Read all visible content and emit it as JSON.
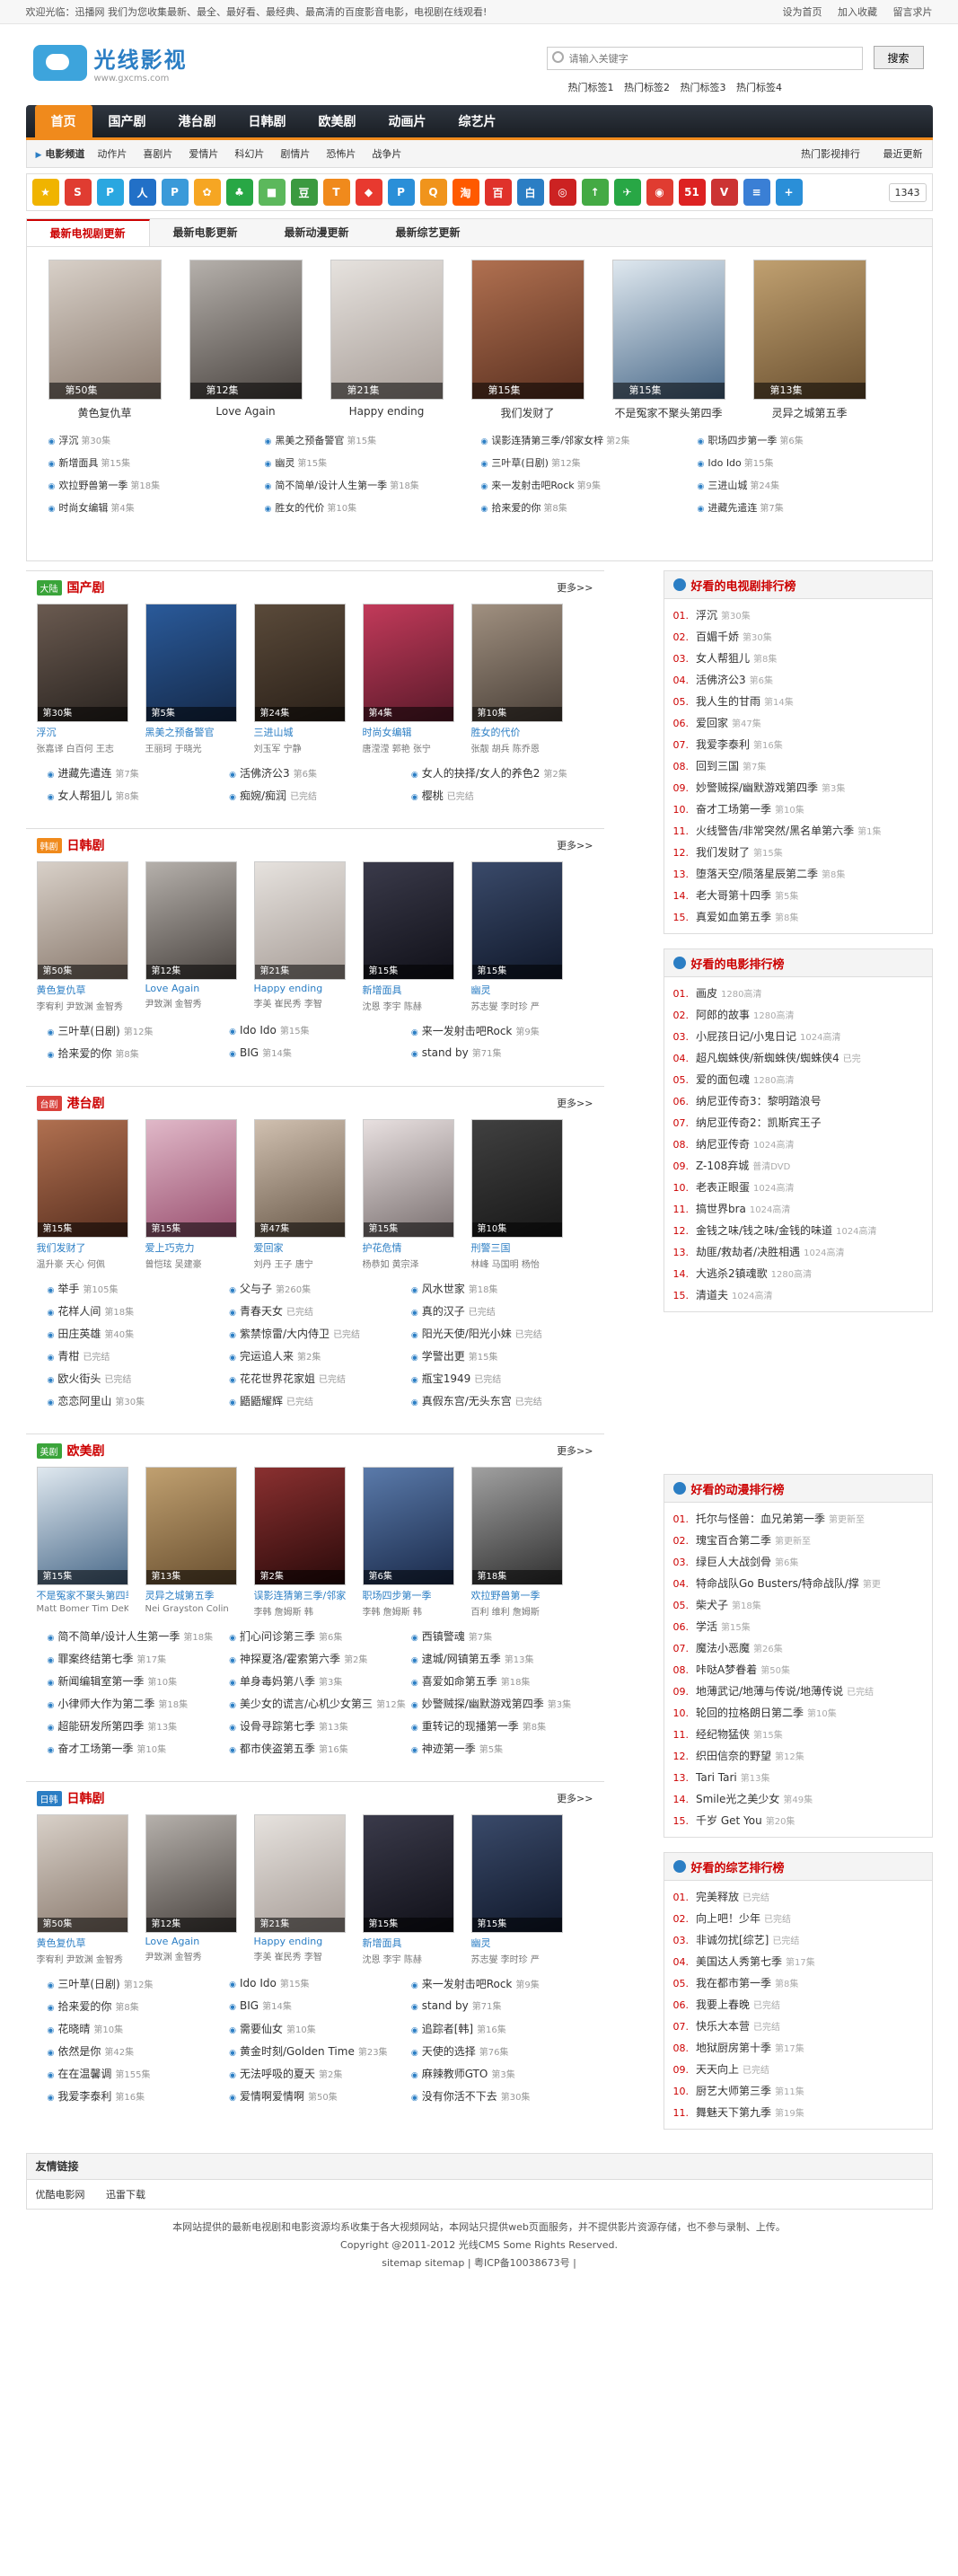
{
  "topbar": {
    "welcome": "欢迎光临：迅播网 我们为您收集最新、最全、最好看、最经典、最高清的百度影音电影，电视剧在线观看!",
    "links": [
      "设为首页",
      "加入收藏",
      "留言求片"
    ]
  },
  "header": {
    "logo_name": "光线影视",
    "logo_domain": "www.gxcms.com",
    "search_placeholder": "请输入关键字",
    "search_button": "搜索",
    "hotwords": [
      "热门标签1",
      "热门标签2",
      "热门标签3",
      "热门标签4"
    ]
  },
  "nav": {
    "items": [
      "首页",
      "国产剧",
      "港台剧",
      "日韩剧",
      "欧美剧",
      "动画片",
      "综艺片"
    ]
  },
  "subnav": {
    "label": "电影频道",
    "cats": [
      "动作片",
      "喜剧片",
      "爱情片",
      "科幻片",
      "剧情片",
      "恐怖片",
      "战争片"
    ],
    "right": [
      "热门影视排行",
      "最近更新"
    ]
  },
  "iconbar": {
    "icons": [
      {
        "t": "★",
        "c": "#f0b400"
      },
      {
        "t": "S",
        "c": "#e03c31"
      },
      {
        "t": "P",
        "c": "#2aa7e0"
      },
      {
        "t": "人",
        "c": "#2270c7"
      },
      {
        "t": "P",
        "c": "#3a9ad9"
      },
      {
        "t": "✿",
        "c": "#f6a623"
      },
      {
        "t": "♣",
        "c": "#28a745"
      },
      {
        "t": "■",
        "c": "#5cb85c"
      },
      {
        "t": "豆",
        "c": "#3b9a40"
      },
      {
        "t": "T",
        "c": "#f08a1c"
      },
      {
        "t": "◆",
        "c": "#e8392f"
      },
      {
        "t": "P",
        "c": "#2a8fd8"
      },
      {
        "t": "Q",
        "c": "#f0941c"
      },
      {
        "t": "淘",
        "c": "#ff5a00"
      },
      {
        "t": "百",
        "c": "#e0322b"
      },
      {
        "t": "白",
        "c": "#2b7ec4"
      },
      {
        "t": "◎",
        "c": "#cc2222"
      },
      {
        "t": "↑",
        "c": "#44aa44"
      },
      {
        "t": "✈",
        "c": "#28a745"
      },
      {
        "t": "◉",
        "c": "#e03c31"
      },
      {
        "t": "51",
        "c": "#dd2222"
      },
      {
        "t": "V",
        "c": "#cc3333"
      },
      {
        "t": "≡",
        "c": "#3a7fd5"
      },
      {
        "t": "+",
        "c": "#2a8fd8"
      }
    ],
    "count": "1343"
  },
  "newbox": {
    "tabs": [
      "最新电视剧更新",
      "最新电影更新",
      "最新动漫更新",
      "最新综艺更新"
    ],
    "posters": [
      {
        "ep": "第50集",
        "title": "黄色复仇草",
        "c1": "#d8d0c8",
        "c2": "#8a7a6e"
      },
      {
        "ep": "第12集",
        "title": "Love Again",
        "c1": "#b5b0ab",
        "c2": "#4a4440"
      },
      {
        "ep": "第21集",
        "title": "Happy ending",
        "c1": "#e6e2de",
        "c2": "#a79d97"
      },
      {
        "ep": "第15集",
        "title": "我们发财了",
        "c1": "#b07050",
        "c2": "#5a3020"
      },
      {
        "ep": "第15集",
        "title": "不是冤家不聚头第四季",
        "c1": "#dfe8ef",
        "c2": "#4a6a8a"
      },
      {
        "ep": "第13集",
        "title": "灵异之城第五季",
        "c1": "#c0a070",
        "c2": "#6a5030"
      }
    ],
    "list": [
      {
        "t": "浮沉",
        "s": "第30集"
      },
      {
        "t": "黑美之预备警官",
        "s": "第15集"
      },
      {
        "t": "误影连猜第三季/邻家女梓",
        "s": "第2集"
      },
      {
        "t": "职场四步第一季",
        "s": "第6集"
      },
      {
        "t": "新增面具",
        "s": "第15集"
      },
      {
        "t": "幽灵",
        "s": "第15集"
      },
      {
        "t": "三叶草(日剧)",
        "s": "第12集"
      },
      {
        "t": "Ido Ido",
        "s": "第15集"
      },
      {
        "t": "欢拉野兽第一季",
        "s": "第18集"
      },
      {
        "t": "简不简单/设计人生第一季",
        "s": "第18集"
      },
      {
        "t": "来一发射击吧Rock",
        "s": "第9集"
      },
      {
        "t": "三进山城",
        "s": "第24集"
      },
      {
        "t": "时尚女编辑",
        "s": "第4集"
      },
      {
        "t": "胜女的代价",
        "s": "第10集"
      },
      {
        "t": "拾来爱的你",
        "s": "第8集"
      },
      {
        "t": "进藏先遣连",
        "s": "第7集"
      }
    ]
  },
  "sections": [
    {
      "badge": "大陆",
      "bc": "#3aa43a",
      "title": "国产剧",
      "more": "更多>>",
      "posters": [
        {
          "ep": "第30集",
          "title": "浮沉",
          "actors": "张嘉译 白百何 王志",
          "c1": "#6a5a50",
          "c2": "#2a2420"
        },
        {
          "ep": "第5集",
          "title": "黑美之预备警官",
          "actors": "王丽珂 于晓光",
          "c1": "#2a5a9a",
          "c2": "#152a4a"
        },
        {
          "ep": "第24集",
          "title": "三进山城",
          "actors": "刘玉军 宁静",
          "c1": "#5a4a3a",
          "c2": "#2a2018"
        },
        {
          "ep": "第4集",
          "title": "时尚女编辑",
          "actors": "唐滢滢 郭艳 张宁",
          "c1": "#c23a5a",
          "c2": "#5a1a2a"
        },
        {
          "ep": "第10集",
          "title": "胜女的代价",
          "actors": "张靓 胡兵 陈乔恩",
          "c1": "#a09080",
          "c2": "#4a4038"
        }
      ],
      "list": [
        {
          "t": "进藏先遣连",
          "s": "第7集"
        },
        {
          "t": "活佛济公3",
          "s": "第6集"
        },
        {
          "t": "女人的抉择/女人的养色2",
          "s": "第2集"
        },
        {
          "t": "女人帮狙儿",
          "s": "第8集"
        },
        {
          "t": "痴婉/痴润",
          "s": "已完结"
        },
        {
          "t": "樱桃",
          "s": "已完结"
        }
      ]
    },
    {
      "badge": "韩剧",
      "bc": "#f08a1c",
      "title": "日韩剧",
      "more": "更多>>",
      "posters": [
        {
          "ep": "第50集",
          "title": "黄色复仇草",
          "actors": "李宥利 尹致渊 金智秀",
          "c1": "#d8d0c8",
          "c2": "#8a7a6e"
        },
        {
          "ep": "第12集",
          "title": "Love Again",
          "actors": "尹致渊 金智秀",
          "c1": "#b5b0ab",
          "c2": "#4a4440"
        },
        {
          "ep": "第21集",
          "title": "Happy ending",
          "actors": "李美 崔民秀 李智",
          "c1": "#e6e2de",
          "c2": "#a79d97"
        },
        {
          "ep": "第15集",
          "title": "新增面具",
          "actors": "沈恩 李宇 陈赫",
          "c1": "#3a3a4a",
          "c2": "#101018"
        },
        {
          "ep": "第15集",
          "title": "幽灵",
          "actors": "苏志燮 李时珍 严",
          "c1": "#3a4a6a",
          "c2": "#10182a"
        }
      ],
      "list": [
        {
          "t": "三叶草(日剧)",
          "s": "第12集"
        },
        {
          "t": "Ido Ido",
          "s": "第15集"
        },
        {
          "t": "来一发射击吧Rock",
          "s": "第9集"
        },
        {
          "t": "拾来爱的你",
          "s": "第8集"
        },
        {
          "t": "BIG",
          "s": "第14集"
        },
        {
          "t": "stand by",
          "s": "第71集"
        }
      ]
    },
    {
      "badge": "台剧",
      "bc": "#d9413b",
      "title": "港台剧",
      "more": "更多>>",
      "posters": [
        {
          "ep": "第15集",
          "title": "我们发财了",
          "actors": "温升豪 天心 何佩",
          "c1": "#b07050",
          "c2": "#5a3020"
        },
        {
          "ep": "第15集",
          "title": "爱上巧克力",
          "actors": "曾恺玹 吴建豪",
          "c1": "#e0b8c8",
          "c2": "#9a5070"
        },
        {
          "ep": "第47集",
          "title": "爱回家",
          "actors": "刘丹 王子 唐宁",
          "c1": "#d0c0b0",
          "c2": "#6a5a4a"
        },
        {
          "ep": "第15集",
          "title": "护花危情",
          "actors": "杨恭如 黄宗泽",
          "c1": "#e8e0e0",
          "c2": "#7a7070"
        },
        {
          "ep": "第10集",
          "title": "刑警三国",
          "actors": "林峰 马国明 杨怡",
          "c1": "#404040",
          "c2": "#181818"
        }
      ],
      "list": [
        {
          "t": "举手",
          "s": "第105集"
        },
        {
          "t": "父与子",
          "s": "第260集"
        },
        {
          "t": "风水世家",
          "s": "第18集"
        },
        {
          "t": "花样人间",
          "s": "第18集"
        },
        {
          "t": "青春天女",
          "s": "已完结"
        },
        {
          "t": "真的汉子",
          "s": "已完结"
        },
        {
          "t": "田庄英雄",
          "s": "第40集"
        },
        {
          "t": "紫禁惊雷/大内侍卫",
          "s": "已完结"
        },
        {
          "t": "阳光天使/阳光小妹",
          "s": "已完结"
        },
        {
          "t": "青柑",
          "s": "已完结"
        },
        {
          "t": "完运追人来",
          "s": "第2集"
        },
        {
          "t": "学警出更",
          "s": "第15集"
        },
        {
          "t": "欧火街头",
          "s": "已完结"
        },
        {
          "t": "花花世界花家姐",
          "s": "已完结"
        },
        {
          "t": "瓶宝1949",
          "s": "已完结"
        },
        {
          "t": "恋恋阿里山",
          "s": "第30集"
        },
        {
          "t": "鼯鼯耀辉",
          "s": "已完结"
        },
        {
          "t": "真假东宫/无头东宫",
          "s": "已完结"
        }
      ]
    },
    {
      "badge": "美剧",
      "bc": "#3aa43a",
      "title": "欧美剧",
      "more": "更多>>",
      "posters": [
        {
          "ep": "第15集",
          "title": "不是冤家不聚头第四季",
          "actors": "Matt Bomer Tim DeKay",
          "c1": "#dfe8ef",
          "c2": "#4a6a8a"
        },
        {
          "ep": "第13集",
          "title": "灵异之城第五季",
          "actors": "Nei Grayston Colin",
          "c1": "#c0a070",
          "c2": "#6a5030"
        },
        {
          "ep": "第2集",
          "title": "误影连猜第三季/邻家女",
          "actors": "李韩 詹姆斯 韩",
          "c1": "#8a3030",
          "c2": "#2a0a0a"
        },
        {
          "ep": "第6集",
          "title": "职场四步第一季",
          "actors": "李韩 詹姆斯 韩",
          "c1": "#5a7aaa",
          "c2": "#1a2a4a"
        },
        {
          "ep": "第18集",
          "title": "欢拉野兽第一季",
          "actors": "百利 维利 詹姆斯",
          "c1": "#a0a0a0",
          "c2": "#303030"
        }
      ],
      "list": [
        {
          "t": "简不简单/设计人生第一季",
          "s": "第18集"
        },
        {
          "t": "扪心问诊第三季",
          "s": "第6集"
        },
        {
          "t": "西镇警魂",
          "s": "第7集"
        },
        {
          "t": "罪案终结第七季",
          "s": "第17集"
        },
        {
          "t": "神探夏洛/霍索第六季",
          "s": "第2集"
        },
        {
          "t": "逮城/网镇第五季",
          "s": "第13集"
        },
        {
          "t": "新闻编辑室第一季",
          "s": "第10集"
        },
        {
          "t": "单身毒妈第八季",
          "s": "第3集"
        },
        {
          "t": "喜爱如命第五季",
          "s": "第18集"
        },
        {
          "t": "小律师大作为第二季",
          "s": "第18集"
        },
        {
          "t": "美少女的谎言/心机少女第三",
          "s": "第12集"
        },
        {
          "t": "妙警贼探/幽默游戏第四季",
          "s": "第3集"
        },
        {
          "t": "超能研发所第四季",
          "s": "第13集"
        },
        {
          "t": "设骨寻踪第七季",
          "s": "第13集"
        },
        {
          "t": "重转记的现播第一季",
          "s": "第8集"
        },
        {
          "t": "奋才工场第一季",
          "s": "第10集"
        },
        {
          "t": "都市侠盗第五季",
          "s": "第16集"
        },
        {
          "t": "神迹第一季",
          "s": "第5集"
        }
      ]
    },
    {
      "badge": "日韩",
      "bc": "#2b7ec4",
      "title": "日韩剧",
      "more": "更多>>",
      "posters": [
        {
          "ep": "第50集",
          "title": "黄色复仇草",
          "actors": "李宥利 尹致渊 金智秀",
          "c1": "#d8d0c8",
          "c2": "#8a7a6e"
        },
        {
          "ep": "第12集",
          "title": "Love Again",
          "actors": "尹致渊 金智秀",
          "c1": "#b5b0ab",
          "c2": "#4a4440"
        },
        {
          "ep": "第21集",
          "title": "Happy ending",
          "actors": "李美 崔民秀 李智",
          "c1": "#e6e2de",
          "c2": "#a79d97"
        },
        {
          "ep": "第15集",
          "title": "新增面具",
          "actors": "沈恩 李宇 陈赫",
          "c1": "#3a3a4a",
          "c2": "#101018"
        },
        {
          "ep": "第15集",
          "title": "幽灵",
          "actors": "苏志燮 李时珍 严",
          "c1": "#3a4a6a",
          "c2": "#10182a"
        }
      ],
      "list": [
        {
          "t": "三叶草(日剧)",
          "s": "第12集"
        },
        {
          "t": "Ido Ido",
          "s": "第15集"
        },
        {
          "t": "来一发射击吧Rock",
          "s": "第9集"
        },
        {
          "t": "拾来爱的你",
          "s": "第8集"
        },
        {
          "t": "BIG",
          "s": "第14集"
        },
        {
          "t": "stand by",
          "s": "第71集"
        },
        {
          "t": "花晓晴",
          "s": "第10集"
        },
        {
          "t": "需要仙女",
          "s": "第10集"
        },
        {
          "t": "追踪者[韩]",
          "s": "第16集"
        },
        {
          "t": "依然是你",
          "s": "第42集"
        },
        {
          "t": "黄金时刻/Golden Time",
          "s": "第23集"
        },
        {
          "t": "天使的选择",
          "s": "第76集"
        },
        {
          "t": "在在温馨调",
          "s": "第155集"
        },
        {
          "t": "无法呼吸的夏天",
          "s": "第2集"
        },
        {
          "t": "麻辣教师GTO",
          "s": "第3集"
        },
        {
          "t": "我爱李泰利",
          "s": "第16集"
        },
        {
          "t": "爱情啊爱情啊",
          "s": "第50集"
        },
        {
          "t": "没有你活不下去",
          "s": "第30集"
        }
      ]
    }
  ],
  "ranks": [
    {
      "title": "好看的电视剧排行榜",
      "items": [
        {
          "n": "01.",
          "t": "浮沉",
          "s": "第30集"
        },
        {
          "n": "02.",
          "t": "百媚千娇",
          "s": "第30集"
        },
        {
          "n": "03.",
          "t": "女人帮狙儿",
          "s": "第8集"
        },
        {
          "n": "04.",
          "t": "活佛济公3",
          "s": "第6集"
        },
        {
          "n": "05.",
          "t": "我人生的甘雨",
          "s": "第14集"
        },
        {
          "n": "06.",
          "t": "爱回家",
          "s": "第47集"
        },
        {
          "n": "07.",
          "t": "我爱李泰利",
          "s": "第16集"
        },
        {
          "n": "08.",
          "t": "回到三国",
          "s": "第7集"
        },
        {
          "n": "09.",
          "t": "妙警贼探/幽默游戏第四季",
          "s": "第3集"
        },
        {
          "n": "10.",
          "t": "奋才工场第一季",
          "s": "第10集"
        },
        {
          "n": "11.",
          "t": "火线警告/非常突然/黑名单第六季",
          "s": "第1集"
        },
        {
          "n": "12.",
          "t": "我们发财了",
          "s": "第15集"
        },
        {
          "n": "13.",
          "t": "堕落天空/陨落星辰第二季",
          "s": "第8集"
        },
        {
          "n": "14.",
          "t": "老大哥第十四季",
          "s": "第5集"
        },
        {
          "n": "15.",
          "t": "真爱如血第五季",
          "s": "第8集"
        }
      ]
    },
    {
      "title": "好看的电影排行榜",
      "items": [
        {
          "n": "01.",
          "t": "画皮",
          "s": "1280高清"
        },
        {
          "n": "02.",
          "t": "阿郎的故事",
          "s": "1280高清"
        },
        {
          "n": "03.",
          "t": "小屁孩日记/小鬼日记",
          "s": "1024高清"
        },
        {
          "n": "04.",
          "t": "超凡蜘蛛侠/新蜘蛛侠/蜘蛛侠4",
          "s": "已完"
        },
        {
          "n": "05.",
          "t": "爱的面包魂",
          "s": "1280高清"
        },
        {
          "n": "06.",
          "t": "纳尼亚传奇3：黎明踏浪号",
          "s": ""
        },
        {
          "n": "07.",
          "t": "纳尼亚传奇2：凯斯宾王子",
          "s": ""
        },
        {
          "n": "08.",
          "t": "纳尼亚传奇",
          "s": "1024高清"
        },
        {
          "n": "09.",
          "t": "Z-108弃城",
          "s": "普清DVD"
        },
        {
          "n": "10.",
          "t": "老表正眼蛋",
          "s": "1024高清"
        },
        {
          "n": "11.",
          "t": "搞世界bra",
          "s": "1024高清"
        },
        {
          "n": "12.",
          "t": "金钱之味/钱之味/金钱的味道",
          "s": "1024高清"
        },
        {
          "n": "13.",
          "t": "劫匪/救劫者/决胜相遇",
          "s": "1024高清"
        },
        {
          "n": "14.",
          "t": "大逃杀2镇魂歌",
          "s": "1280高清"
        },
        {
          "n": "15.",
          "t": "清道夫",
          "s": "1024高清"
        }
      ]
    },
    {
      "title": "好看的动漫排行榜",
      "items": [
        {
          "n": "01.",
          "t": "托尔与怪兽：血兄弟第一季",
          "s": "第更新至"
        },
        {
          "n": "02.",
          "t": "瑰宝百合第二季",
          "s": "第更新至"
        },
        {
          "n": "03.",
          "t": "绿巨人大战剑骨",
          "s": "第6集"
        },
        {
          "n": "04.",
          "t": "特命战队Go Busters/特命战队/撑",
          "s": "第更"
        },
        {
          "n": "05.",
          "t": "柴犬子",
          "s": "第18集"
        },
        {
          "n": "06.",
          "t": "学活",
          "s": "第15集"
        },
        {
          "n": "07.",
          "t": "魔法小恶魔",
          "s": "第26集"
        },
        {
          "n": "08.",
          "t": "咔哒A梦眷着",
          "s": "第50集"
        },
        {
          "n": "09.",
          "t": "地薄武记/地薄与传说/地薄传说",
          "s": "已完结"
        },
        {
          "n": "10.",
          "t": "轮回的拉格朗日第二季",
          "s": "第10集"
        },
        {
          "n": "11.",
          "t": "经纪物猛侠",
          "s": "第15集"
        },
        {
          "n": "12.",
          "t": "织田信奈的野望",
          "s": "第12集"
        },
        {
          "n": "13.",
          "t": "Tari Tari",
          "s": "第13集"
        },
        {
          "n": "14.",
          "t": "Smile光之美少女",
          "s": "第49集"
        },
        {
          "n": "15.",
          "t": "千岁 Get You",
          "s": "第20集"
        }
      ]
    },
    {
      "title": "好看的综艺排行榜",
      "items": [
        {
          "n": "01.",
          "t": "完美释放",
          "s": "已完结"
        },
        {
          "n": "02.",
          "t": "向上吧！少年",
          "s": "已完结"
        },
        {
          "n": "03.",
          "t": "非诚勿扰[综艺]",
          "s": "已完结"
        },
        {
          "n": "04.",
          "t": "美国达人秀第七季",
          "s": "第17集"
        },
        {
          "n": "05.",
          "t": "我在都市第一季",
          "s": "第8集"
        },
        {
          "n": "06.",
          "t": "我要上春晚",
          "s": "已完结"
        },
        {
          "n": "07.",
          "t": "快乐大本营",
          "s": "已完结"
        },
        {
          "n": "08.",
          "t": "地狱厨房第十季",
          "s": "第17集"
        },
        {
          "n": "09.",
          "t": "天天向上",
          "s": "已完结"
        },
        {
          "n": "10.",
          "t": "厨艺大师第三季",
          "s": "第11集"
        },
        {
          "n": "11.",
          "t": "舞魅天下第九季",
          "s": "第19集"
        }
      ]
    }
  ],
  "friendlinks": {
    "title": "友情链接",
    "items": [
      "优酷电影网",
      "迅雷下载"
    ]
  },
  "footer": {
    "line1": "本网站提供的最新电视剧和电影资源均系收集于各大视频网站，本网站只提供web页面服务，并不提供影片资源存储，也不参与录制、上传。",
    "line2": "Copyright @2011-2012 光线CMS Some Rights Reserved.",
    "line3": "sitemap sitemap | 粤ICP备10038673号 |"
  }
}
